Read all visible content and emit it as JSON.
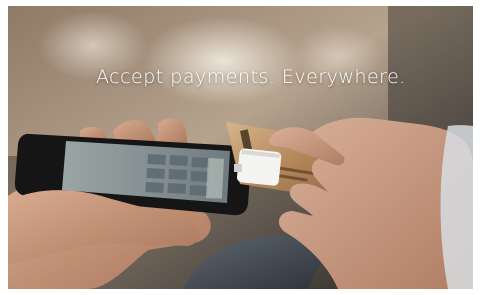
{
  "hero": {
    "tagline": "Accept payments. Everywhere."
  },
  "colors": {
    "tagline": "#ffffff",
    "background_warm": "#b39f8a",
    "background_dark": "#3a3631",
    "skin": "#c79b80",
    "card": "#b58a5c",
    "reader": "#f4f4f2",
    "phone_body": "#151515",
    "phone_screen": "#8d9a9c"
  }
}
